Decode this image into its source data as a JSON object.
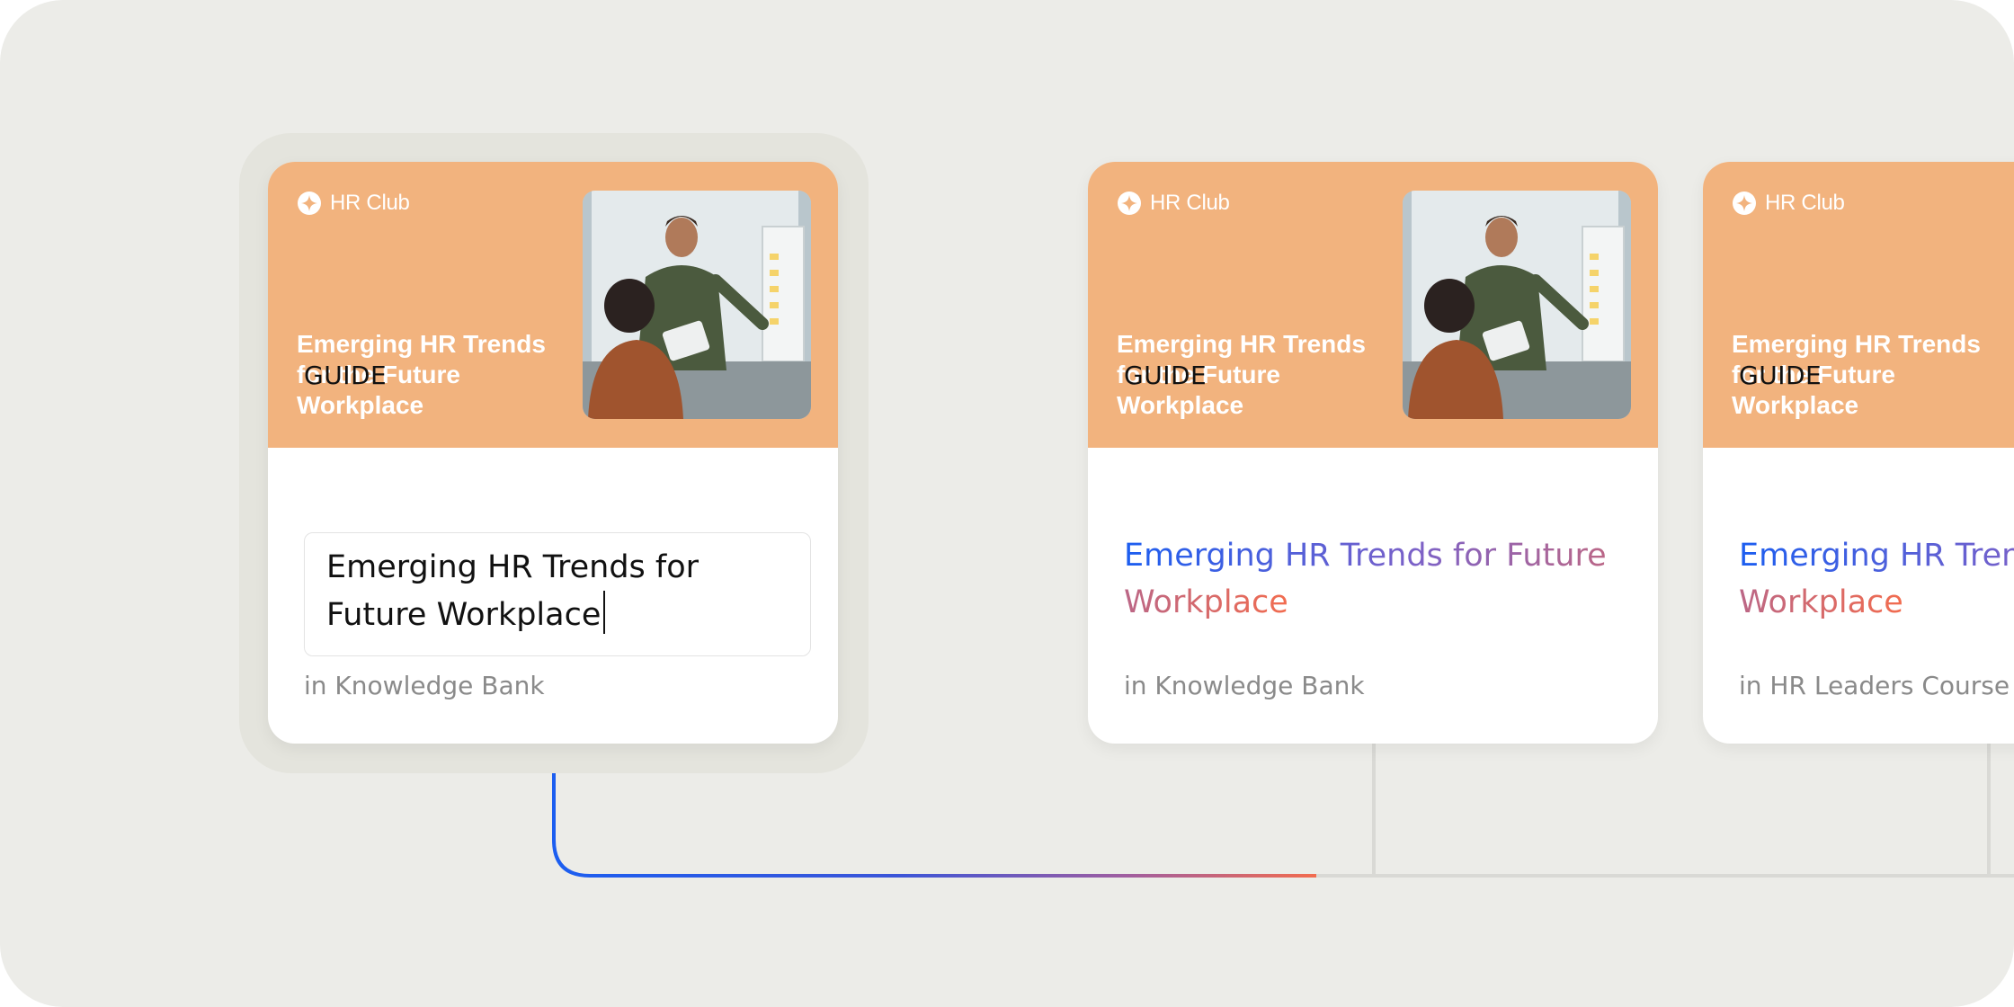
{
  "cards": [
    {
      "brand": "HR Club",
      "header_title": "Emerging HR Trends for the Future Workplace",
      "type": "GUIDE",
      "title": "Emerging HR Trends for Future Workplace",
      "location": "in Knowledge Bank",
      "state": "editing"
    },
    {
      "brand": "HR Club",
      "header_title": "Emerging HR Trends for the Future Workplace",
      "type": "GUIDE",
      "title": "Emerging HR Trends for Future Workplace",
      "location": "in Knowledge Bank",
      "state": "display"
    },
    {
      "brand": "HR Club",
      "header_title": "Emerging HR Trends for the Future Workplace",
      "type": "GUIDE",
      "title": "Emerging HR Trends for Future Workplace",
      "location": "in HR Leaders Course",
      "state": "display"
    }
  ],
  "colors": {
    "background": "#ecece8",
    "header": "#f2b37e",
    "gradient_start": "#1c5ef0",
    "gradient_mid": "#7b61c8",
    "gradient_end": "#f26c4f",
    "connector_grey": "#d9d9d5"
  },
  "icons": {
    "brand": "sparkle-icon",
    "photo": "presentation-photo"
  }
}
